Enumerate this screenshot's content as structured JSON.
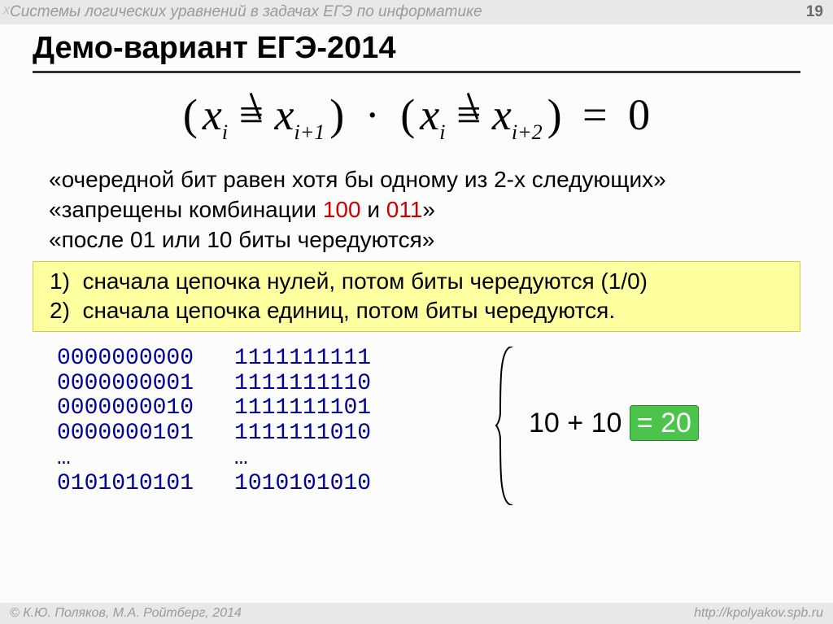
{
  "header": {
    "topic": "Системы логических уравнений в задачах ЕГЭ по информатике",
    "page_number": "19"
  },
  "title": "Демо-вариант ЕГЭ-2014",
  "formula": {
    "parts": {
      "var": "x",
      "sub1": "i",
      "sub2": "i+1",
      "sub3": "i+2",
      "neq": "≡",
      "mul": "·",
      "eq": "=",
      "zero": "0",
      "lp": "(",
      "rp": ")"
    }
  },
  "lines": {
    "l1a": "«очередной бит равен хотя бы одному из 2-х следующих»",
    "l2a": "«запрещены комбинации ",
    "l2b": "100",
    "l2c": " и ",
    "l2d": "011",
    "l2e": "»",
    "l3a": "«после 01 или 10 биты чередуются»"
  },
  "yellow": {
    "n1": "1)",
    "t1": "сначала цепочка нулей, потом биты чередуются (1/0)",
    "n2": "2)",
    "t2": "сначала цепочка единиц, потом биты чередуются."
  },
  "bits": {
    "left": [
      "0000000000",
      "0000000001",
      "0000000010",
      "0000000101",
      "…",
      "0101010101"
    ],
    "right": [
      "1111111111",
      "1111111110",
      "1111111101",
      "1111111010",
      "…",
      "1010101010"
    ]
  },
  "result": {
    "lhs": "10 + 10 ",
    "hl": "= 20"
  },
  "footer": {
    "left": "© К.Ю. Поляков, М.А. Ройтберг, 2014",
    "right": "http://kpolyakov.spb.ru"
  }
}
